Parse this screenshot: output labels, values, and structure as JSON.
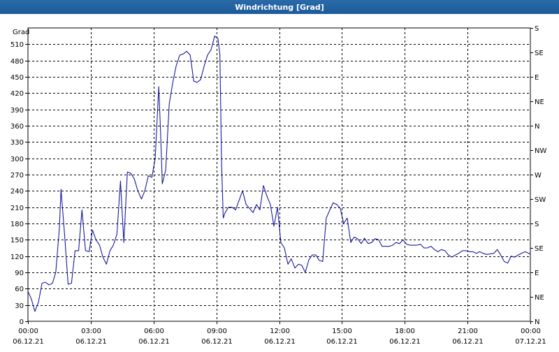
{
  "window": {
    "title": "Windrichtung [Grad]"
  },
  "chart_data": {
    "type": "line",
    "title": "Windrichtung [Grad]",
    "ylabel": "Grad",
    "xlabel": "",
    "ylim": [
      0,
      540
    ],
    "xlim_hours": [
      0,
      24
    ],
    "grid": true,
    "colors": {
      "series": "#1a1aa0",
      "grid": "#000000",
      "axis": "#000000"
    },
    "yticks": [
      0,
      30,
      60,
      90,
      120,
      150,
      180,
      210,
      240,
      270,
      300,
      330,
      360,
      390,
      420,
      450,
      480,
      510
    ],
    "right_ticks": [
      {
        "value": 0,
        "label": "N"
      },
      {
        "value": 45,
        "label": "NE"
      },
      {
        "value": 90,
        "label": "E"
      },
      {
        "value": 135,
        "label": "SE"
      },
      {
        "value": 180,
        "label": "S"
      },
      {
        "value": 225,
        "label": "SW"
      },
      {
        "value": 270,
        "label": "W"
      },
      {
        "value": 315,
        "label": "NW"
      },
      {
        "value": 360,
        "label": "N"
      },
      {
        "value": 405,
        "label": "NE"
      },
      {
        "value": 450,
        "label": "E"
      },
      {
        "value": 495,
        "label": "SE"
      },
      {
        "value": 540,
        "label": "S"
      }
    ],
    "xticks": [
      {
        "hour": 0,
        "time": "00:00",
        "date": "06.12.21"
      },
      {
        "hour": 3,
        "time": "03:00",
        "date": "06.12.21"
      },
      {
        "hour": 6,
        "time": "06:00",
        "date": "06.12.21"
      },
      {
        "hour": 9,
        "time": "09:00",
        "date": "06.12.21"
      },
      {
        "hour": 12,
        "time": "12:00",
        "date": "06.12.21"
      },
      {
        "hour": 15,
        "time": "15:00",
        "date": "06.12.21"
      },
      {
        "hour": 18,
        "time": "18:00",
        "date": "06.12.21"
      },
      {
        "hour": 21,
        "time": "21:00",
        "date": "06.12.21"
      },
      {
        "hour": 24,
        "time": "00:00",
        "date": "07.12.21"
      }
    ],
    "series": [
      {
        "points": [
          [
            0.0,
            55
          ],
          [
            0.17,
            40
          ],
          [
            0.33,
            18
          ],
          [
            0.5,
            35
          ],
          [
            0.67,
            70
          ],
          [
            0.83,
            72
          ],
          [
            1.0,
            67
          ],
          [
            1.17,
            70
          ],
          [
            1.33,
            90
          ],
          [
            1.5,
            170
          ],
          [
            1.58,
            243
          ],
          [
            1.75,
            160
          ],
          [
            1.92,
            68
          ],
          [
            2.08,
            70
          ],
          [
            2.25,
            130
          ],
          [
            2.42,
            130
          ],
          [
            2.58,
            205
          ],
          [
            2.75,
            130
          ],
          [
            2.92,
            128
          ],
          [
            3.08,
            168
          ],
          [
            3.25,
            150
          ],
          [
            3.42,
            140
          ],
          [
            3.58,
            118
          ],
          [
            3.75,
            105
          ],
          [
            3.92,
            130
          ],
          [
            4.08,
            140
          ],
          [
            4.25,
            160
          ],
          [
            4.42,
            258
          ],
          [
            4.58,
            145
          ],
          [
            4.75,
            275
          ],
          [
            4.92,
            272
          ],
          [
            5.08,
            262
          ],
          [
            5.25,
            240
          ],
          [
            5.42,
            225
          ],
          [
            5.58,
            240
          ],
          [
            5.75,
            268
          ],
          [
            5.92,
            265
          ],
          [
            6.08,
            300
          ],
          [
            6.25,
            432
          ],
          [
            6.33,
            355
          ],
          [
            6.42,
            253
          ],
          [
            6.58,
            278
          ],
          [
            6.75,
            400
          ],
          [
            6.92,
            440
          ],
          [
            7.08,
            470
          ],
          [
            7.25,
            490
          ],
          [
            7.42,
            492
          ],
          [
            7.58,
            497
          ],
          [
            7.75,
            490
          ],
          [
            7.92,
            442
          ],
          [
            8.08,
            440
          ],
          [
            8.25,
            445
          ],
          [
            8.42,
            470
          ],
          [
            8.58,
            490
          ],
          [
            8.75,
            500
          ],
          [
            8.92,
            525
          ],
          [
            9.08,
            520
          ],
          [
            9.17,
            490
          ],
          [
            9.25,
            290
          ],
          [
            9.33,
            190
          ],
          [
            9.42,
            200
          ],
          [
            9.58,
            210
          ],
          [
            9.75,
            210
          ],
          [
            9.92,
            205
          ],
          [
            10.08,
            222
          ],
          [
            10.25,
            240
          ],
          [
            10.42,
            215
          ],
          [
            10.58,
            208
          ],
          [
            10.75,
            200
          ],
          [
            10.92,
            215
          ],
          [
            11.08,
            205
          ],
          [
            11.25,
            250
          ],
          [
            11.42,
            230
          ],
          [
            11.58,
            215
          ],
          [
            11.75,
            175
          ],
          [
            11.92,
            210
          ],
          [
            12.08,
            145
          ],
          [
            12.25,
            135
          ],
          [
            12.42,
            105
          ],
          [
            12.58,
            115
          ],
          [
            12.75,
            98
          ],
          [
            12.92,
            105
          ],
          [
            13.08,
            103
          ],
          [
            13.25,
            90
          ],
          [
            13.42,
            113
          ],
          [
            13.58,
            122
          ],
          [
            13.75,
            122
          ],
          [
            13.92,
            112
          ],
          [
            14.08,
            110
          ],
          [
            14.25,
            190
          ],
          [
            14.42,
            205
          ],
          [
            14.58,
            218
          ],
          [
            14.75,
            215
          ],
          [
            14.92,
            208
          ],
          [
            15.08,
            180
          ],
          [
            15.25,
            190
          ],
          [
            15.42,
            145
          ],
          [
            15.58,
            155
          ],
          [
            15.75,
            152
          ],
          [
            15.92,
            143
          ],
          [
            16.08,
            153
          ],
          [
            16.25,
            143
          ],
          [
            16.42,
            145
          ],
          [
            16.58,
            152
          ],
          [
            16.75,
            150
          ],
          [
            16.92,
            138
          ],
          [
            17.08,
            138
          ],
          [
            17.25,
            138
          ],
          [
            17.42,
            140
          ],
          [
            17.58,
            145
          ],
          [
            17.75,
            143
          ],
          [
            17.92,
            150
          ],
          [
            18.08,
            142
          ],
          [
            18.25,
            140
          ],
          [
            18.42,
            140
          ],
          [
            18.58,
            140
          ],
          [
            18.75,
            142
          ],
          [
            18.92,
            135
          ],
          [
            19.08,
            135
          ],
          [
            19.25,
            138
          ],
          [
            19.42,
            132
          ],
          [
            19.58,
            128
          ],
          [
            19.75,
            132
          ],
          [
            19.92,
            130
          ],
          [
            20.08,
            122
          ],
          [
            20.25,
            118
          ],
          [
            20.42,
            122
          ],
          [
            20.58,
            125
          ],
          [
            20.75,
            130
          ],
          [
            20.92,
            130
          ],
          [
            21.08,
            128
          ],
          [
            21.25,
            128
          ],
          [
            21.42,
            125
          ],
          [
            21.58,
            128
          ],
          [
            21.75,
            125
          ],
          [
            21.92,
            123
          ],
          [
            22.08,
            124
          ],
          [
            22.25,
            125
          ],
          [
            22.42,
            132
          ],
          [
            22.58,
            122
          ],
          [
            22.75,
            110
          ],
          [
            22.92,
            107
          ],
          [
            23.08,
            120
          ],
          [
            23.25,
            118
          ],
          [
            23.42,
            122
          ],
          [
            23.58,
            125
          ],
          [
            23.75,
            128
          ],
          [
            23.92,
            125
          ],
          [
            24.0,
            124
          ]
        ]
      }
    ]
  }
}
